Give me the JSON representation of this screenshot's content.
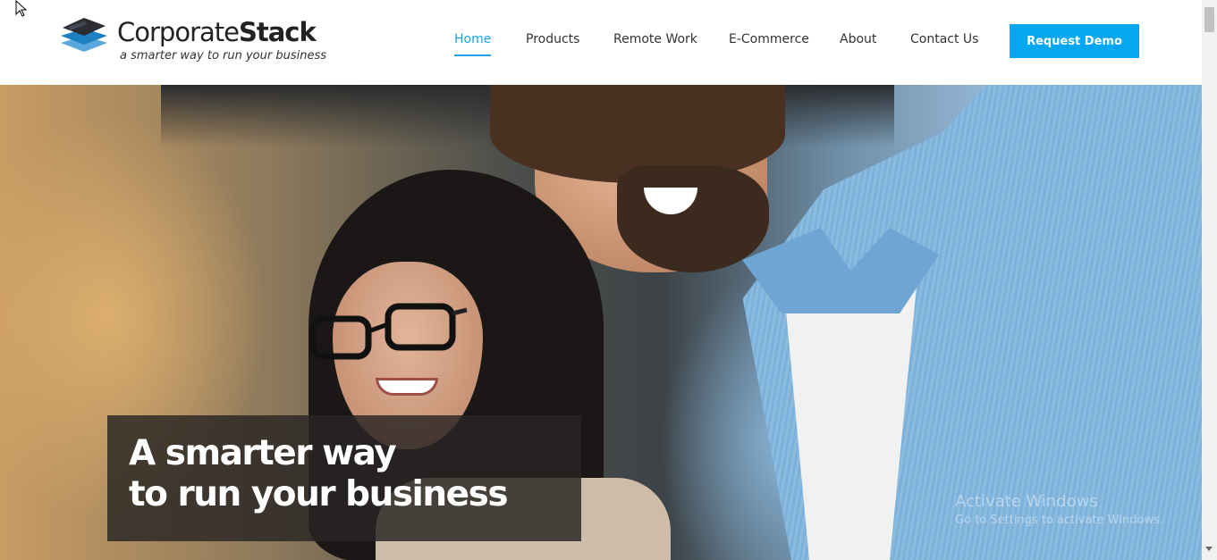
{
  "brand": {
    "name_part1": "Corporate",
    "name_part2": "Stack",
    "tagline": "a smarter way to run your business",
    "colors": {
      "dark_layer": "#2b2d33",
      "mid_layer": "#1e7fc1",
      "light_layer": "#5aa7dc"
    }
  },
  "nav": {
    "items": [
      {
        "label": "Home",
        "active": true
      },
      {
        "label": "Products",
        "active": false
      },
      {
        "label": "Remote Work",
        "active": false
      },
      {
        "label": "E-Commerce",
        "active": false
      },
      {
        "label": "About",
        "active": false
      },
      {
        "label": "Contact Us",
        "active": false
      }
    ],
    "cta_label": "Request Demo",
    "accent_color": "#1ea1e6",
    "cta_color": "#05a8f0"
  },
  "hero": {
    "title_line1": "A smarter way",
    "title_line2": "to run your business",
    "image": "two-people-smiling-at-screen-photo"
  },
  "watermark": {
    "line1": "Activate Windows",
    "line2": "Go to Settings to activate Windows."
  },
  "icons": {
    "logo": "stacked-layers-logo-icon",
    "cursor": "mouse-pointer-icon"
  }
}
